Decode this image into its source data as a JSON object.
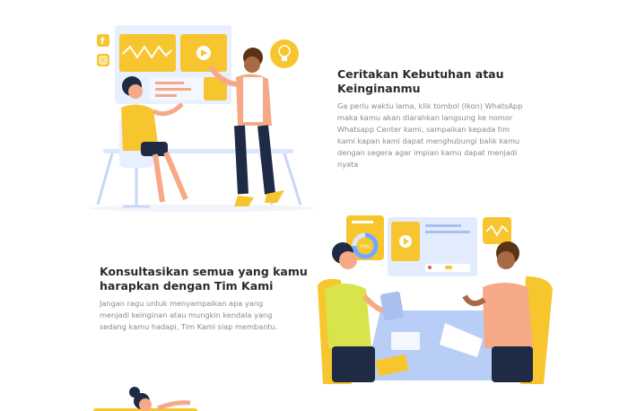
{
  "sections": [
    {
      "title": "Ceritakan Kebutuhan atau\nKeinginanmu",
      "description": "Ga perlu waktu lama, klik tombol (Ikon) WhatsApp\nmaka kamu akan diarahkan langsung ke nomor\nWhatsapp Center kami, sampaikan kepada tim\nkami kapan kami dapat menghubungi balik kamu\ndengan segera agar impian kamu dapat menjadi\nnyata",
      "illustration": "woman-at-desk-and-man-presenting-dashboard"
    },
    {
      "title": "Konsultasikan semua yang kamu\nharapkan dengan Tim Kami",
      "description": "Jangan ragu untuk menyampaikan apa yang\nmenjadi keinginan atau mungkin kendala yang\nsedang kamu hadapi, Tim Kami siap membantu.",
      "illustration": "two-people-consulting-at-table",
      "chart_badge": "70%"
    }
  ],
  "colors": {
    "accent_yellow": "#f7c52e",
    "light_blue": "#dbe7ff",
    "skin": "#f6a987",
    "dark": "#1f2a44"
  },
  "icons": [
    "facebook-icon",
    "instagram-icon",
    "lightbulb-icon",
    "play-icon"
  ]
}
